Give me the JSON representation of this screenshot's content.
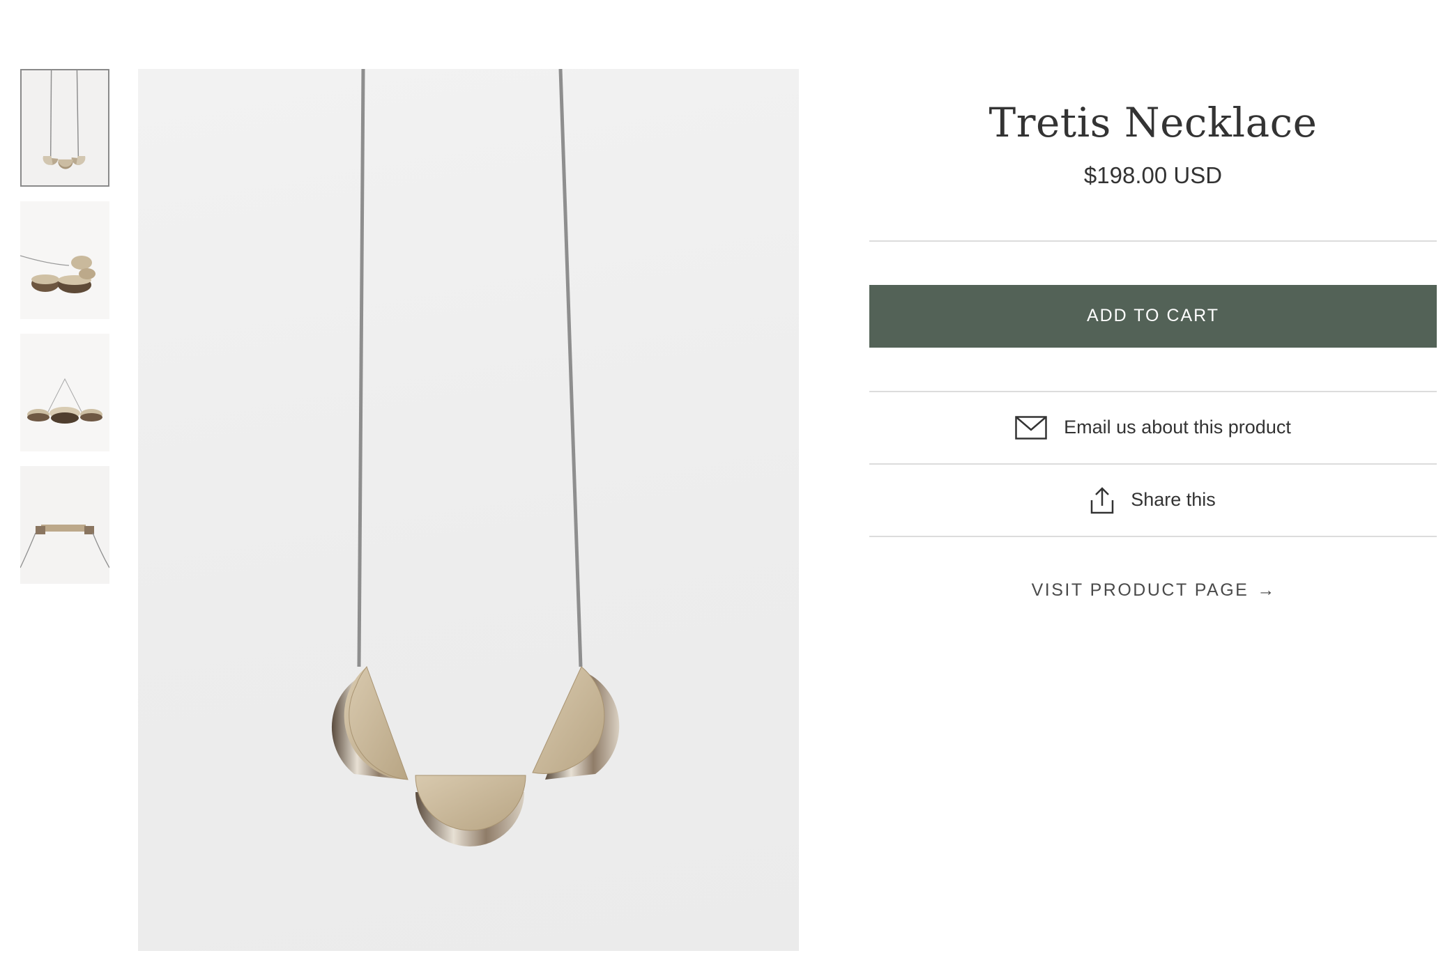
{
  "product": {
    "title": "Tretis Necklace",
    "price": "$198.00 USD"
  },
  "gallery": {
    "thumbnails": [
      {
        "icon": "necklace-front-thumbnail",
        "active": true
      },
      {
        "icon": "necklace-side-thumbnail",
        "active": false
      },
      {
        "icon": "necklace-angle-thumbnail",
        "active": false
      },
      {
        "icon": "necklace-top-thumbnail",
        "active": false
      }
    ],
    "main_image": "necklace-front-photo"
  },
  "actions": {
    "add_to_cart": "ADD TO CART",
    "email": "Email us about this product",
    "email_icon": "envelope-icon",
    "share": "Share this",
    "share_icon": "share-icon",
    "visit": "VISIT PRODUCT PAGE",
    "visit_arrow": "→"
  },
  "colors": {
    "button_bg": "#536257",
    "button_text": "#ffffff",
    "divider": "#dcdcdc",
    "text": "#333333"
  }
}
